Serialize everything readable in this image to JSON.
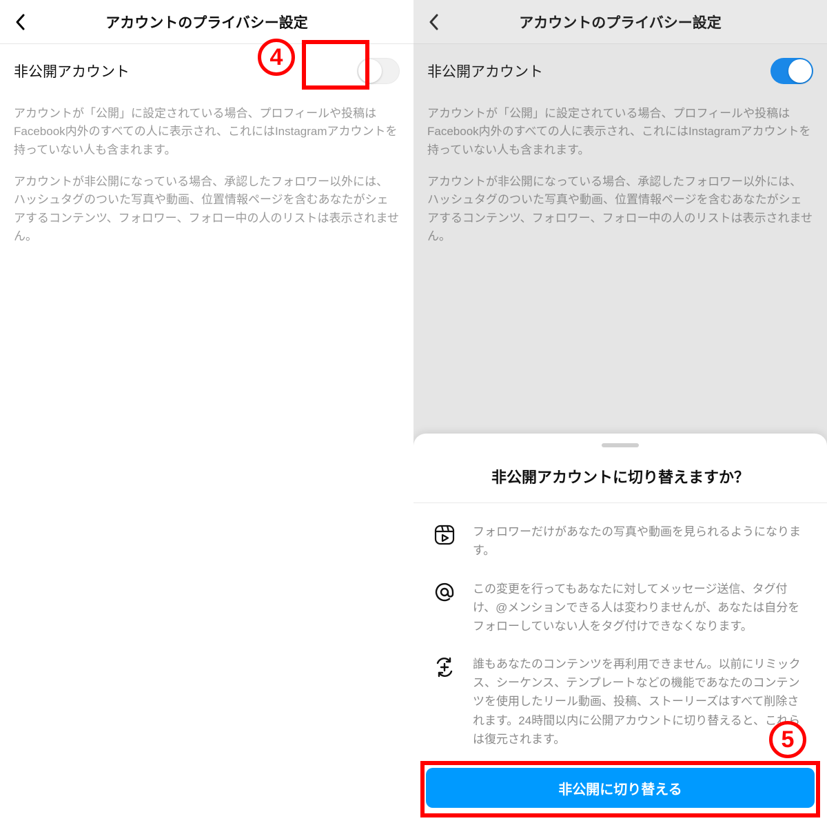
{
  "left": {
    "header_title": "アカウントのプライバシー設定",
    "setting_label": "非公開アカウント",
    "desc1": "アカウントが「公開」に設定されている場合、プロフィールや投稿はFacebook内外のすべての人に表示され、これにはInstagramアカウントを持っていない人も含まれます。",
    "desc2": "アカウントが非公開になっている場合、承認したフォロワー以外には、ハッシュタグのついた写真や動画、位置情報ページを含むあなたがシェアするコンテンツ、フォロワー、フォロー中の人のリストは表示されません。",
    "annotation_number": "4"
  },
  "right": {
    "header_title": "アカウントのプライバシー設定",
    "setting_label": "非公開アカウント",
    "desc1": "アカウントが「公開」に設定されている場合、プロフィールや投稿はFacebook内外のすべての人に表示され、これにはInstagramアカウントを持っていない人も含まれます。",
    "desc2": "アカウントが非公開になっている場合、承認したフォロワー以外には、ハッシュタグのついた写真や動画、位置情報ページを含むあなたがシェアするコンテンツ、フォロワー、フォロー中の人のリストは表示されません。"
  },
  "sheet": {
    "title": "非公開アカウントに切り替えますか？",
    "info1": "フォロワーだけがあなたの写真や動画を見られるようになります。",
    "info2": "この変更を行ってもあなたに対してメッセージ送信、タグ付け、@メンションできる人は変わりませんが、あなたは自分をフォローしていない人をタグ付けできなくなります。",
    "info3": "誰もあなたのコンテンツを再利用できません。以前にリミックス、シーケンス、テンプレートなどの機能であなたのコンテンツを使用したリール動画、投稿、ストーリーズはすべて削除されます。24時間以内に公開アカウントに切り替えると、これらは復元されます。",
    "cta_label": "非公開に切り替える",
    "annotation_number": "5"
  }
}
